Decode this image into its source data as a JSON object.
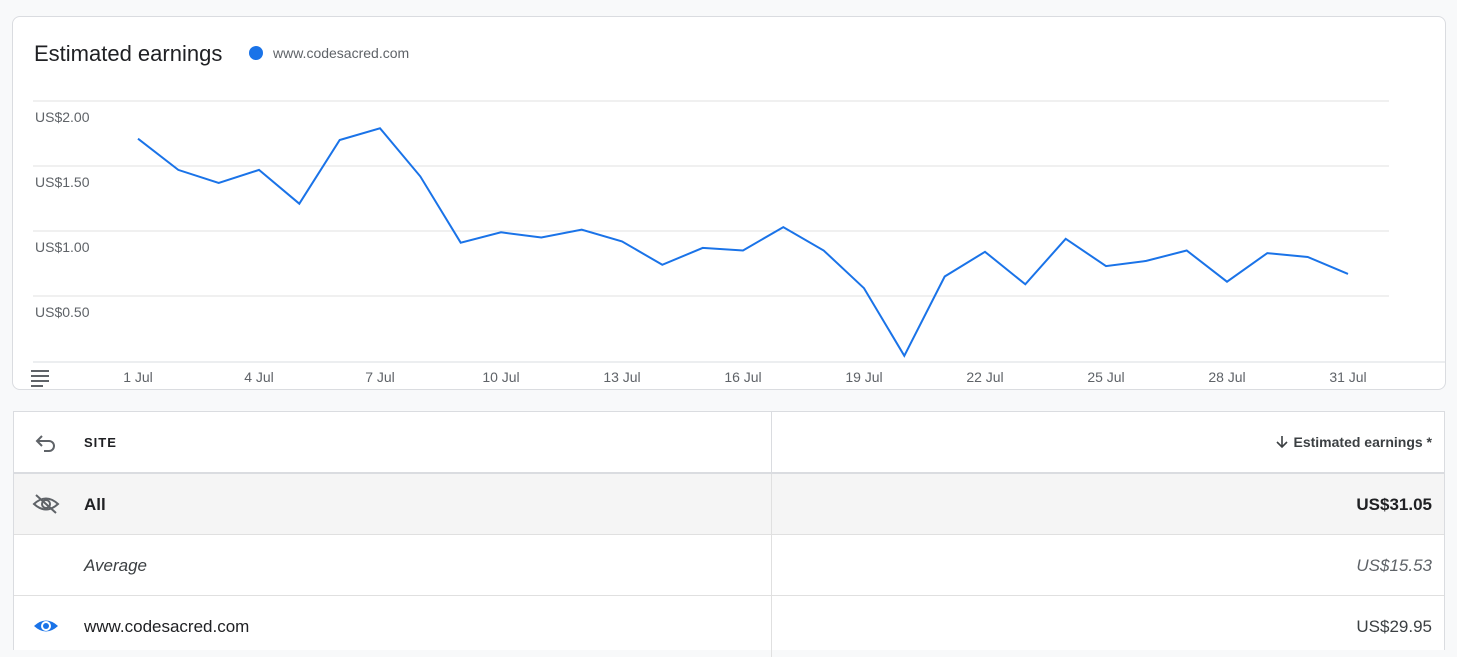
{
  "chart": {
    "title": "Estimated earnings",
    "legend_label": "www.codesacred.com",
    "menu_icon": "menu-lines-icon"
  },
  "chart_data": {
    "type": "line",
    "x": [
      "1 Jul",
      "2 Jul",
      "3 Jul",
      "4 Jul",
      "5 Jul",
      "6 Jul",
      "7 Jul",
      "8 Jul",
      "9 Jul",
      "10 Jul",
      "11 Jul",
      "12 Jul",
      "13 Jul",
      "14 Jul",
      "15 Jul",
      "16 Jul",
      "17 Jul",
      "18 Jul",
      "19 Jul",
      "20 Jul",
      "21 Jul",
      "22 Jul",
      "23 Jul",
      "24 Jul",
      "25 Jul",
      "26 Jul",
      "27 Jul",
      "28 Jul",
      "29 Jul",
      "30 Jul",
      "31 Jul"
    ],
    "x_tick_labels": [
      "1 Jul",
      "4 Jul",
      "7 Jul",
      "10 Jul",
      "13 Jul",
      "16 Jul",
      "19 Jul",
      "22 Jul",
      "25 Jul",
      "28 Jul",
      "31 Jul"
    ],
    "series": [
      {
        "name": "www.codesacred.com",
        "color": "#1a73e8",
        "values": [
          1.71,
          1.47,
          1.37,
          1.47,
          1.21,
          1.7,
          1.79,
          1.42,
          0.91,
          0.99,
          0.95,
          1.01,
          0.92,
          0.74,
          0.87,
          0.85,
          1.03,
          0.85,
          0.56,
          0.04,
          0.65,
          0.84,
          0.59,
          0.94,
          0.73,
          0.77,
          0.85,
          0.61,
          0.83,
          0.8,
          0.67
        ]
      }
    ],
    "y_tick_labels": [
      "US$2.00",
      "US$1.50",
      "US$1.00",
      "US$0.50"
    ],
    "ylim": [
      0,
      2.0
    ],
    "grid": true
  },
  "table": {
    "header": {
      "back_icon": "undo-arrow-icon",
      "site_label": "SITE",
      "sort_icon": "arrow-down-icon",
      "earnings_label": "Estimated earnings *"
    },
    "rows": [
      {
        "icon": "eye-off-icon",
        "label": "All",
        "value": "US$31.05"
      },
      {
        "icon": "",
        "label": "Average",
        "value": "US$15.53"
      },
      {
        "icon": "eye-icon",
        "label": "www.codesacred.com",
        "value": "US$29.95"
      }
    ]
  }
}
